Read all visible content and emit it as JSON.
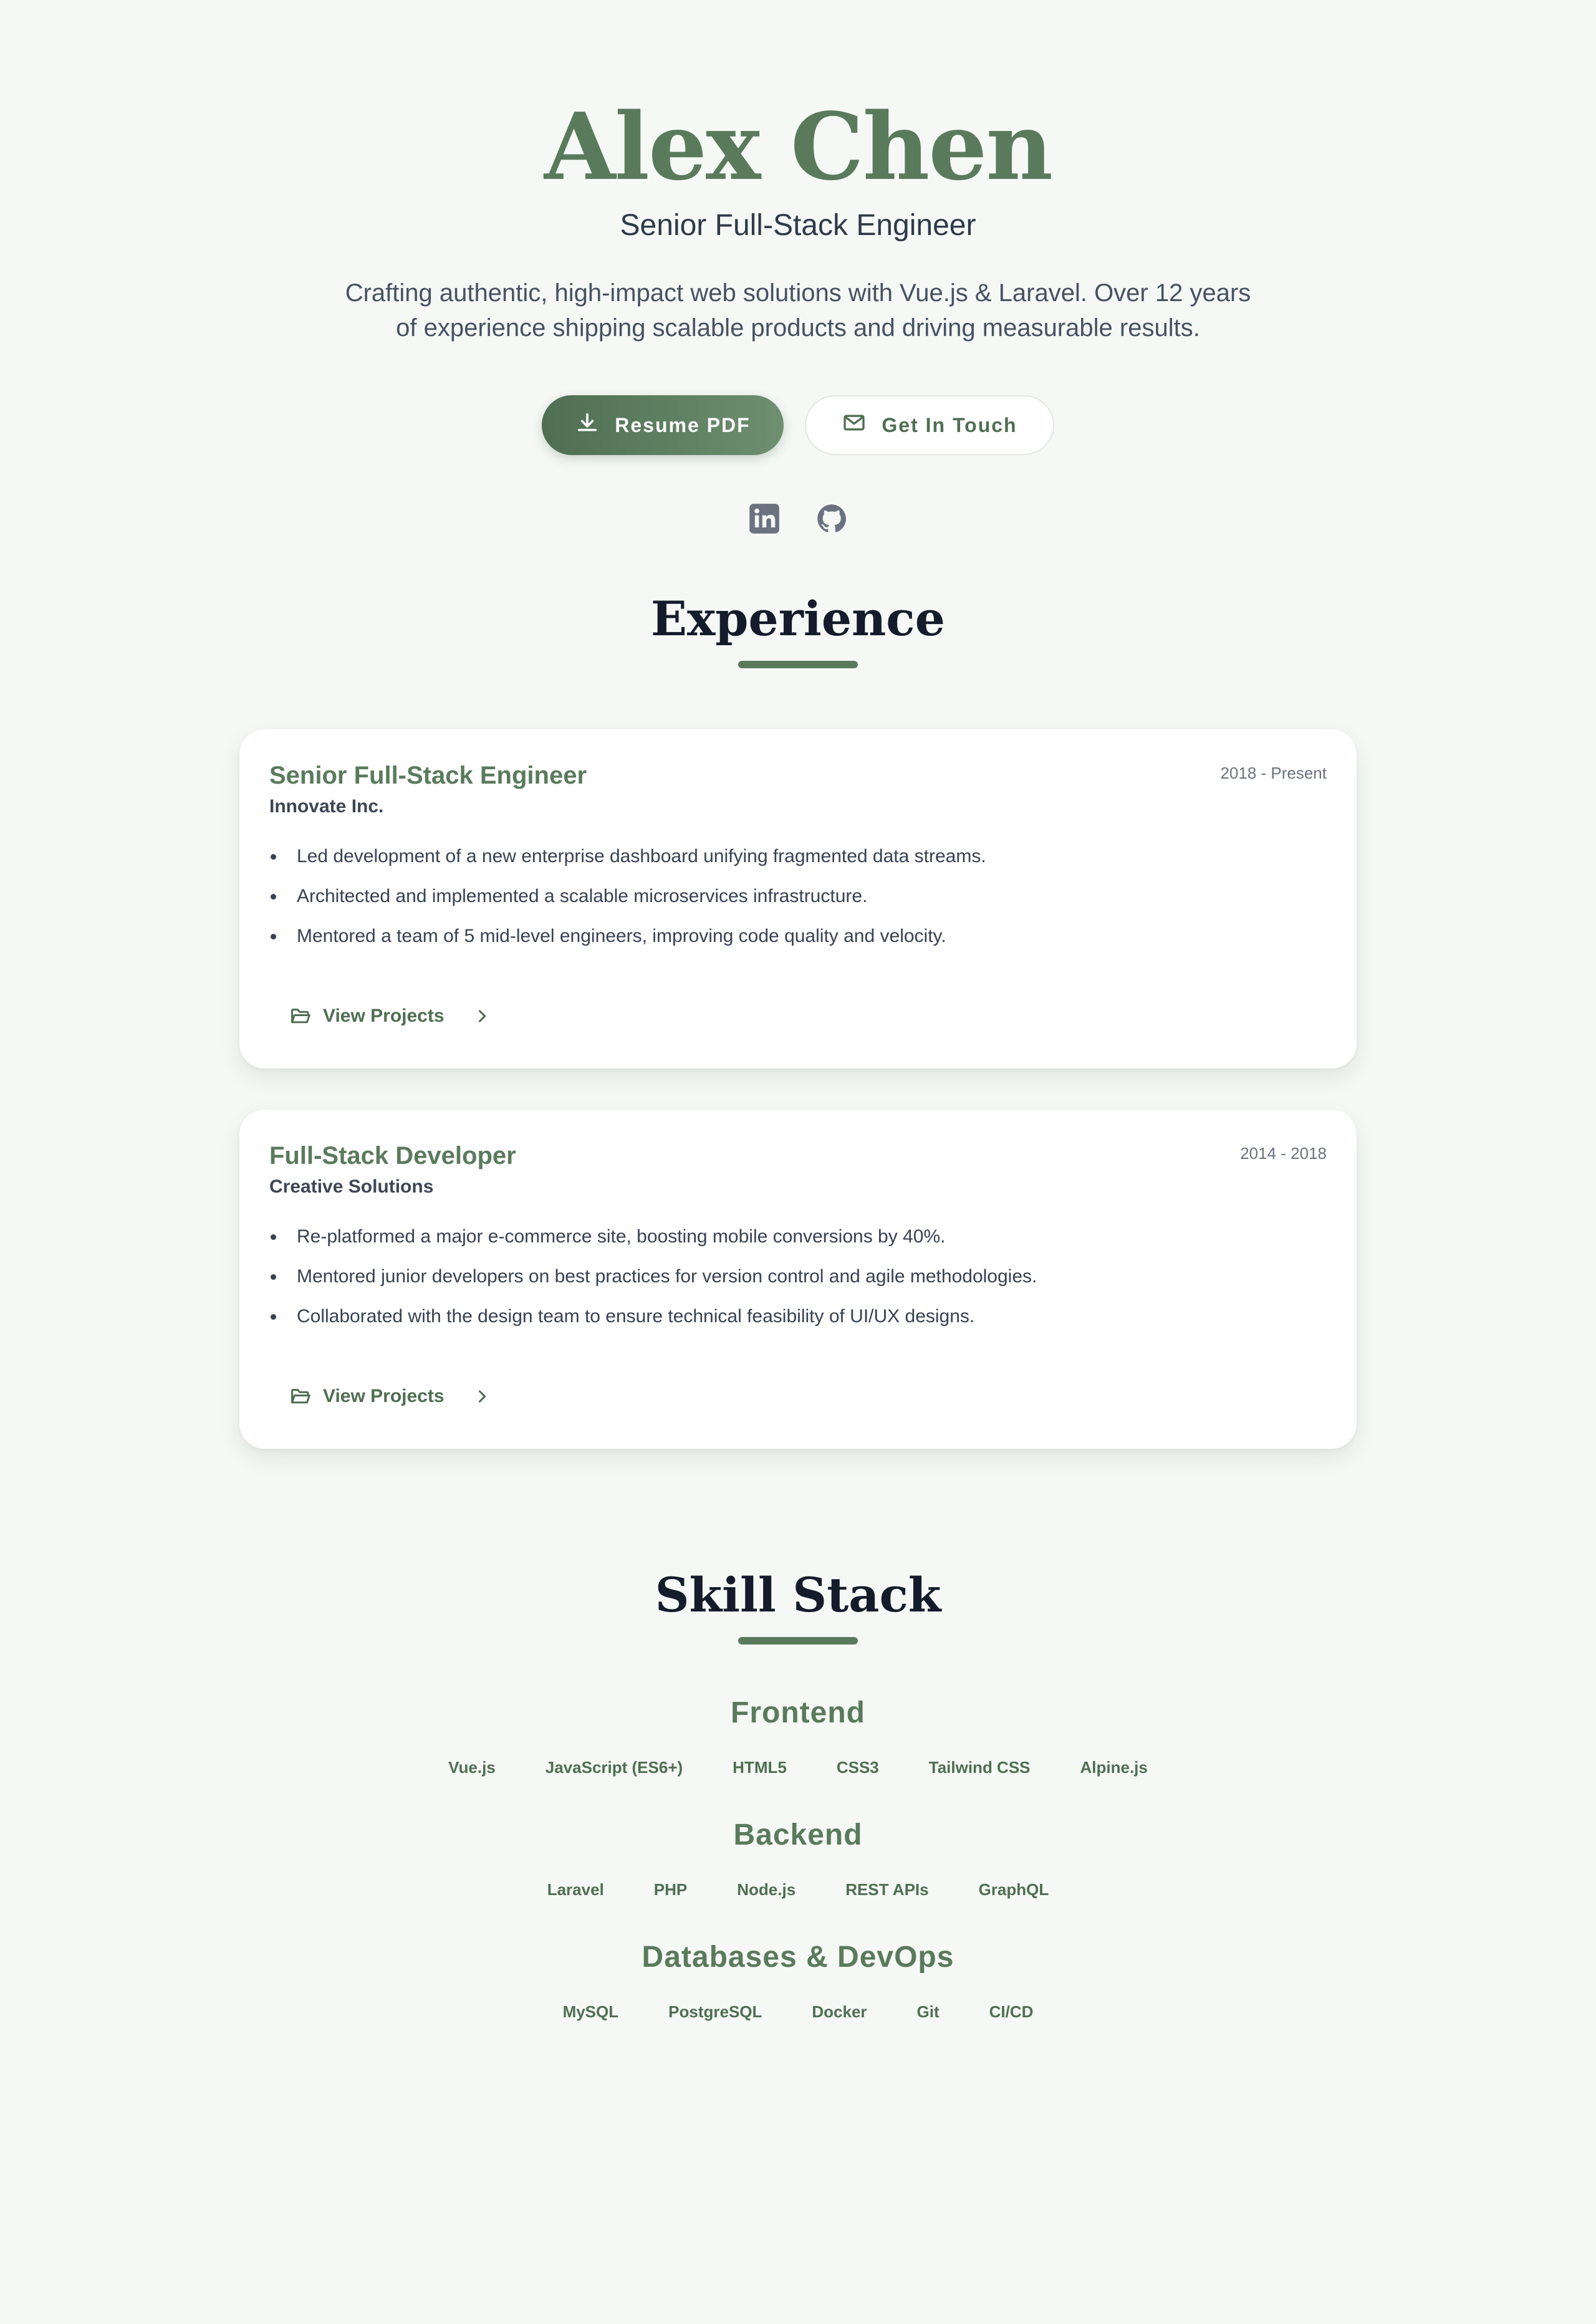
{
  "hero": {
    "name": "Alex Chen",
    "title": "Senior Full-Stack Engineer",
    "tagline": "Crafting authentic, high-impact web solutions with Vue.js & Laravel. Over 12 years of experience shipping scalable products and driving measurable results.",
    "resume_button": "Resume PDF",
    "contact_button": "Get In Touch",
    "social": [
      "linkedin-icon",
      "github-icon"
    ]
  },
  "experience": {
    "title": "Experience",
    "jobs": [
      {
        "role": "Senior Full-Stack Engineer",
        "company": "Innovate Inc.",
        "dates": "2018 - Present",
        "bullets": [
          "Led development of a new enterprise dashboard unifying fragmented data streams.",
          "Architected and implemented a scalable microservices infrastructure.",
          "Mentored a team of 5 mid-level engineers, improving code quality and velocity."
        ],
        "link": "View Projects"
      },
      {
        "role": "Full-Stack Developer",
        "company": "Creative Solutions",
        "dates": "2014 - 2018",
        "bullets": [
          "Re-platformed a major e-commerce site, boosting mobile conversions by 40%.",
          "Mentored junior developers on best practices for version control and agile methodologies.",
          "Collaborated with the design team to ensure technical feasibility of UI/UX designs."
        ],
        "link": "View Projects"
      }
    ]
  },
  "skills": {
    "title": "Skill Stack",
    "groups": [
      {
        "name": "Frontend",
        "items": [
          "Vue.js",
          "JavaScript (ES6+)",
          "HTML5",
          "CSS3",
          "Tailwind CSS",
          "Alpine.js"
        ]
      },
      {
        "name": "Backend",
        "items": [
          "Laravel",
          "PHP",
          "Node.js",
          "REST APIs",
          "GraphQL"
        ]
      },
      {
        "name": "Databases & DevOps",
        "items": [
          "MySQL",
          "PostgreSQL",
          "Docker",
          "Git",
          "CI/CD"
        ]
      }
    ]
  },
  "colors": {
    "accent": "#5a7a5c",
    "background": "#f5f8f5",
    "heading": "#141b2b"
  }
}
